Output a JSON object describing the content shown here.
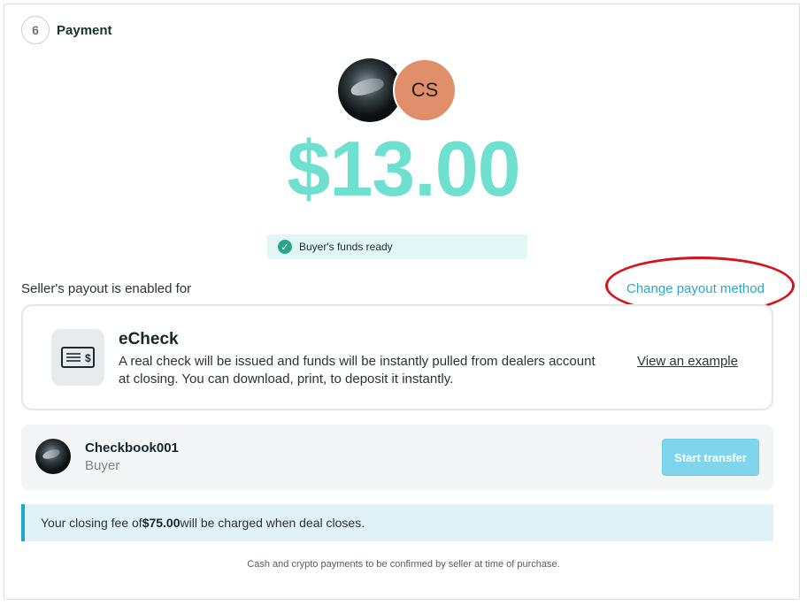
{
  "step": {
    "number": "6",
    "title": "Payment"
  },
  "participants": {
    "seller_avatar": "shark-photo",
    "buyer_initials": "CS",
    "buyer_initials_bg": "#e18f6a"
  },
  "amount": "$13.00",
  "amount_color": "#6fe0d0",
  "funds_status": {
    "icon": "check-circle-icon",
    "text": "Buyer's funds ready"
  },
  "payout": {
    "label": "Seller's payout is enabled for",
    "change_link": "Change payout method"
  },
  "method": {
    "icon": "check-icon",
    "title": "eCheck",
    "description": "A real check will be issued and funds will be instantly pulled from dealers account at closing. You can download, print, to deposit it instantly.",
    "example_link": "View an example"
  },
  "buyer": {
    "name": "Checkbook001",
    "role": "Buyer",
    "action_label": "Start transfer"
  },
  "fee_notice": {
    "prefix": "Your closing fee of ",
    "amount": "$75.00",
    "suffix": " will be charged when deal closes."
  },
  "footnote": "Cash and crypto payments to be confirmed by seller at time of purchase.",
  "colors": {
    "accent": "#2ea7c4",
    "success": "#2aa58a",
    "annotation": "#d6141c"
  }
}
